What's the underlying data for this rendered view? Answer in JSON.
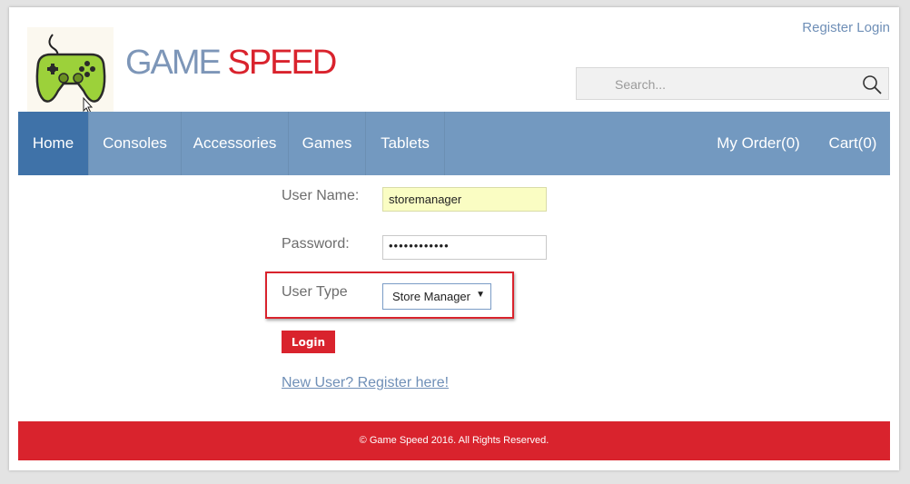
{
  "header": {
    "brand_part1": "GAME ",
    "brand_part2": "SPEED",
    "register_label": "Register",
    "login_label": "Login",
    "search_placeholder": "Search..."
  },
  "nav": {
    "items": [
      {
        "label": "Home",
        "active": true
      },
      {
        "label": "Consoles"
      },
      {
        "label": "Accessories"
      },
      {
        "label": "Games"
      },
      {
        "label": "Tablets"
      }
    ],
    "my_order_label": "My Order(0)",
    "cart_label": "Cart(0)"
  },
  "form": {
    "username_label": "User Name:",
    "username_value": "storemanager",
    "password_label": "Password:",
    "password_value": "••••••••••••",
    "usertype_label": "User Type",
    "usertype_value": "Store Manager",
    "login_button": "Login",
    "register_link": "New User? Register here!"
  },
  "footer": {
    "copyright": "© Game Speed 2016. All Rights Reserved."
  },
  "colors": {
    "brand_blue": "#7d96b8",
    "brand_red": "#d9232d",
    "nav_bg": "#7399c0",
    "nav_active": "#3f72a8",
    "username_bg": "#fafdc3"
  },
  "icons": [
    "gamepad-logo-icon",
    "search-icon",
    "chevron-down-icon"
  ]
}
